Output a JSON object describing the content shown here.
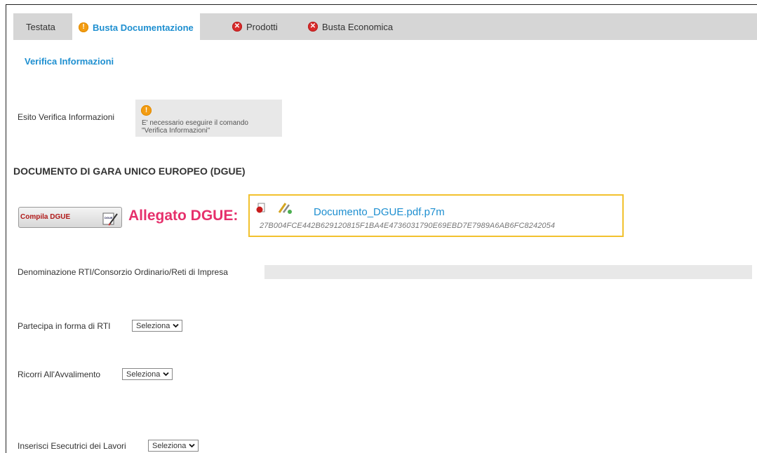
{
  "tabs": [
    {
      "label": "Testata",
      "status": ""
    },
    {
      "label": "Busta Documentazione",
      "status": "warning"
    },
    {
      "label": "Prodotti",
      "status": "error"
    },
    {
      "label": "Busta Economica",
      "status": "error"
    }
  ],
  "icons": {
    "warning": "warning-icon",
    "error": "error-icon",
    "pin": "attachment-pin-icon",
    "signature": "signature-icon",
    "dgue_doc": "dgue-document-icon",
    "chevron": "chevron-down-icon"
  },
  "colors": {
    "link": "#1e8fd0",
    "accent": "#e6306c",
    "highlight": "#f2c12e",
    "warning": "#f39c12",
    "error": "#d92b2b"
  },
  "verifica": {
    "link": "Verifica Informazioni",
    "esito_label": "Esito Verifica Informazioni",
    "message_line1": "E' necessario eseguire il comando",
    "message_line2": "\"Verifica Informazioni\""
  },
  "dgue": {
    "title": "DOCUMENTO DI GARA UNICO EUROPEO (DGUE)",
    "compila_button": "Compila DGUE",
    "allegato_label": "Allegato DGUE:",
    "file_name": "Documento_DGUE.pdf.p7m",
    "hash": "27B004FCE442B629120815F1BA4E4736031790E69EBD7E7989A6AB6FC8242054"
  },
  "fields": {
    "denominazione_label": "Denominazione RTI/Consorzio Ordinario/Reti di Impresa",
    "denominazione_value": "",
    "rti_label": "Partecipa in forma di RTI",
    "rti_value": "Seleziona",
    "avvalimento_label": "Ricorri All'Avvalimento",
    "avvalimento_value": "Seleziona",
    "esecutrici_label": "Inserisci Esecutrici dei Lavori",
    "esecutrici_value": "Seleziona"
  }
}
